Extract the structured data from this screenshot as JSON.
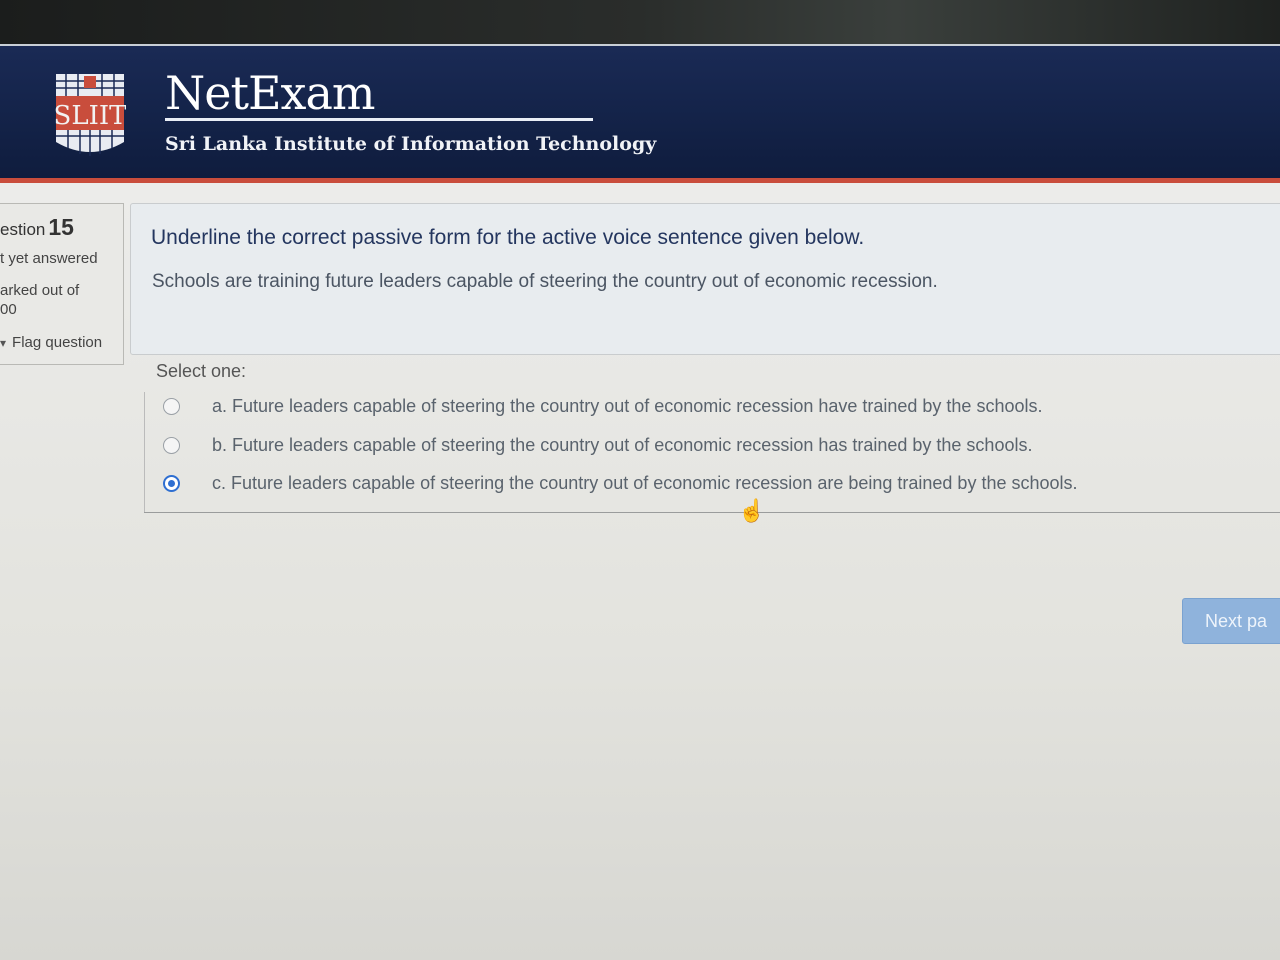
{
  "header": {
    "logo_text": "SLIIT",
    "brand": "NetExam",
    "institute": "Sri Lanka Institute of Information Technology"
  },
  "info": {
    "question_prefix": "estion",
    "question_number": "15",
    "status": "t yet answered",
    "marked_label": "arked out of",
    "marks": "00",
    "flag_label": "Flag question"
  },
  "question": {
    "prompt": "Underline the correct passive form for the active voice sentence given below.",
    "sentence": "Schools are training future leaders capable of steering the country out of economic recession.",
    "select_label": "Select one:",
    "options": [
      {
        "text": "a. Future leaders capable of steering the country out of economic recession have trained by the schools.",
        "checked": false
      },
      {
        "text": "b. Future leaders capable of steering the country out of economic recession has trained by the schools.",
        "checked": false
      },
      {
        "text": "c. Future leaders capable of steering the country out of economic recession are being trained by the schools.",
        "checked": true
      }
    ]
  },
  "nav": {
    "next_label": "Next pa"
  },
  "colors": {
    "header_bg": "#132247",
    "accent_red": "#c94d3c",
    "radio_selected": "#2f6fd1",
    "next_button": "#8fb3dc"
  }
}
